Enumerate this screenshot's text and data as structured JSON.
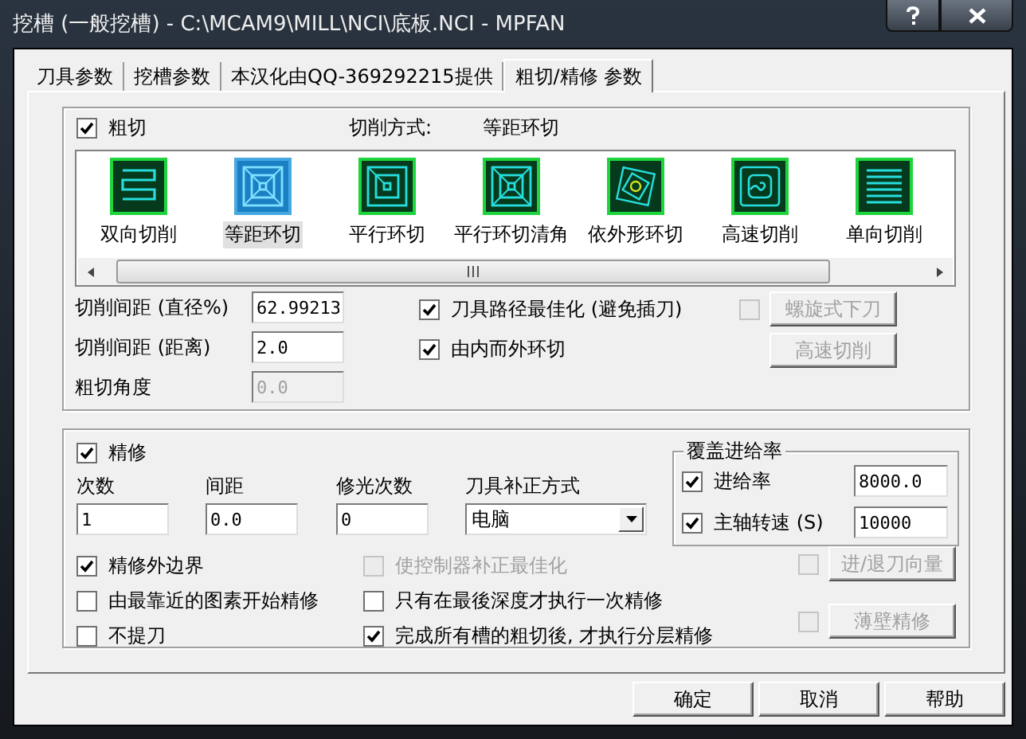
{
  "window": {
    "title": "挖槽 (一般挖槽) - C:\\MCAM9\\MILL\\NCI\\底板.NCI - MPFAN"
  },
  "tabs": [
    {
      "label": "刀具参数",
      "selected": false
    },
    {
      "label": "挖槽参数",
      "selected": false
    },
    {
      "label": "本汉化由QQ-369292215提供",
      "selected": false
    },
    {
      "label": "粗切/精修 参数",
      "selected": true
    }
  ],
  "roughing": {
    "label": "粗切",
    "checked": true,
    "method_label": "切削方式:",
    "method_value": "等距环切",
    "methods": [
      {
        "kind": "zigzag",
        "label": "双向切削",
        "selected": false
      },
      {
        "kind": "constant-overlap",
        "label": "等距环切",
        "selected": true
      },
      {
        "kind": "parallel",
        "label": "平行环切",
        "selected": false
      },
      {
        "kind": "parallel-corner",
        "label": "平行环切清角",
        "selected": false
      },
      {
        "kind": "morph",
        "label": "依外形环切",
        "selected": false
      },
      {
        "kind": "high-speed",
        "label": "高速切削",
        "selected": false
      },
      {
        "kind": "one-way",
        "label": "单向切削",
        "selected": false
      }
    ],
    "fields": [
      {
        "label": "切削间距 (直径%)",
        "value": "62.99213",
        "disabled": false
      },
      {
        "label": "切削间距 (距离)",
        "value": "2.0",
        "disabled": false
      },
      {
        "label": "粗切角度",
        "value": "0.0",
        "disabled": true
      }
    ],
    "options": [
      {
        "label": "刀具路径最佳化 (避免插刀)",
        "checked": true
      },
      {
        "label": "由内而外环切",
        "checked": true
      }
    ],
    "side": [
      {
        "kind": "check-button",
        "checked": false,
        "label": "螺旋式下刀",
        "disabled": true
      },
      {
        "kind": "button",
        "label": "高速切削",
        "disabled": true
      }
    ]
  },
  "finishing": {
    "label": "精修",
    "checked": true,
    "fields": [
      {
        "label": "次数",
        "value": "1"
      },
      {
        "label": "间距",
        "value": "0.0"
      },
      {
        "label": "修光次数",
        "value": "0"
      }
    ],
    "compensation": {
      "label": "刀具补正方式",
      "value": "电脑"
    },
    "left_options": [
      {
        "label": "精修外边界",
        "checked": true
      },
      {
        "label": "由最靠近的图素开始精修",
        "checked": false
      },
      {
        "label": "不提刀",
        "checked": false
      }
    ],
    "middle_options": [
      {
        "label": "使控制器补正最佳化",
        "checked": false,
        "disabled": true
      },
      {
        "label": "只有在最後深度才执行一次精修",
        "checked": false,
        "disabled": false
      },
      {
        "label": "完成所有槽的粗切後, 才执行分层精修",
        "checked": true,
        "disabled": false
      }
    ],
    "override": {
      "title": "覆盖进给率",
      "rows": [
        {
          "label": "进给率",
          "checked": true,
          "value": "8000.0"
        },
        {
          "label": "主轴转速 (S)",
          "checked": true,
          "value": "10000"
        }
      ]
    },
    "side": [
      {
        "label": "进/退刀向量",
        "checked": false,
        "disabled": true
      },
      {
        "label": "薄壁精修",
        "checked": false,
        "disabled": true
      }
    ]
  },
  "buttons": [
    {
      "label": "确定"
    },
    {
      "label": "取消"
    },
    {
      "label": "帮助"
    }
  ]
}
